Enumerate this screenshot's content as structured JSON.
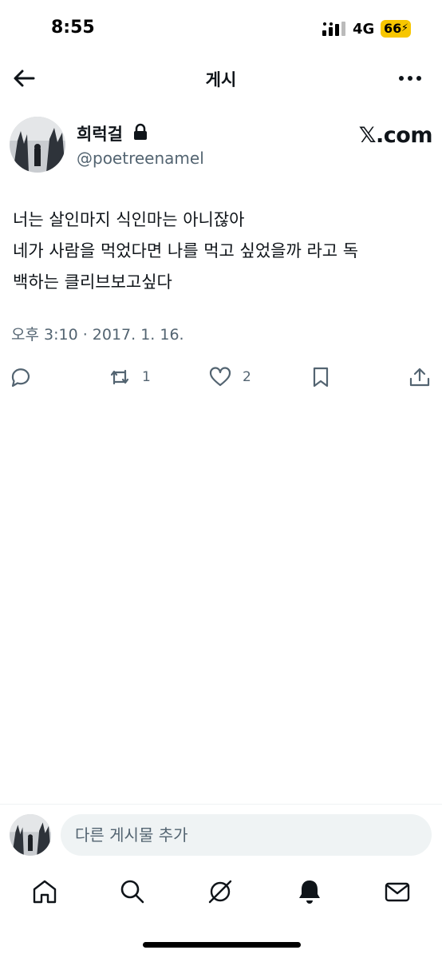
{
  "status_bar": {
    "time": "8:55",
    "network": "4G",
    "battery": "66"
  },
  "nav": {
    "title": "게시"
  },
  "author": {
    "name": "희럭걸",
    "handle": "@poetreenamel",
    "platform": "𝕏.com"
  },
  "tweet": {
    "lines": [
      "너는 살인마지 식인마는 아니잖아",
      "네가 사람을 먹었다면 나를 먹고 싶었을까 라고 독",
      "백하는 클리브보고싶다"
    ],
    "timestamp": "오후 3:10 · 2017. 1. 16."
  },
  "actions": {
    "retweet_count": "1",
    "like_count": "2"
  },
  "reply": {
    "placeholder": "다른 게시물 추가"
  },
  "tabs": [
    "home-icon",
    "search-icon",
    "grok-icon",
    "notifications-icon",
    "messages-icon"
  ],
  "colors": {
    "text": "#0f1419",
    "secondary": "#536471",
    "battery": "#f7c600"
  }
}
